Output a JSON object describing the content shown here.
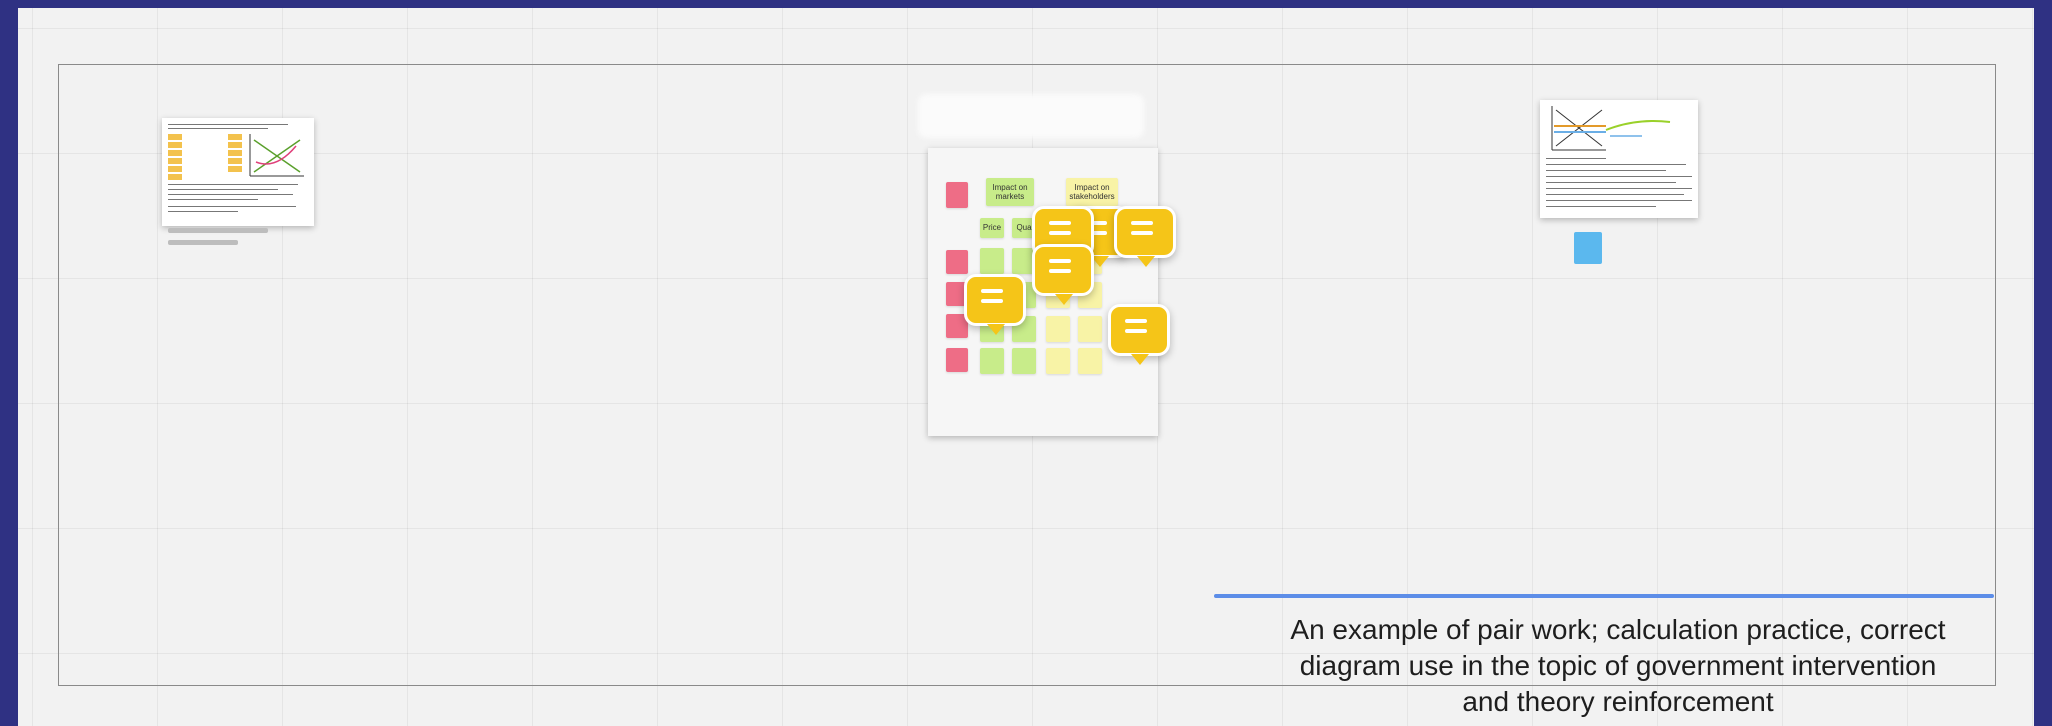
{
  "caption": {
    "text": "An example of pair work; calculation practice, correct diagram use in the topic of government intervention and theory reinforcement"
  },
  "board": {
    "headers": [
      "Impact on markets",
      "Impact on stakeholders"
    ],
    "column_labels": [
      "Price",
      "Qua"
    ]
  },
  "colors": {
    "background": "#2f3183",
    "comment": "#f5c518",
    "sticky_green": "#c8ec8a",
    "sticky_yellow": "#f8f3a6",
    "sticky_red": "#ee6d86",
    "sticky_blue": "#5bb8ee",
    "selection_line": "#5c8de8"
  },
  "icons": {
    "comment": "comment-bubble-icon"
  }
}
